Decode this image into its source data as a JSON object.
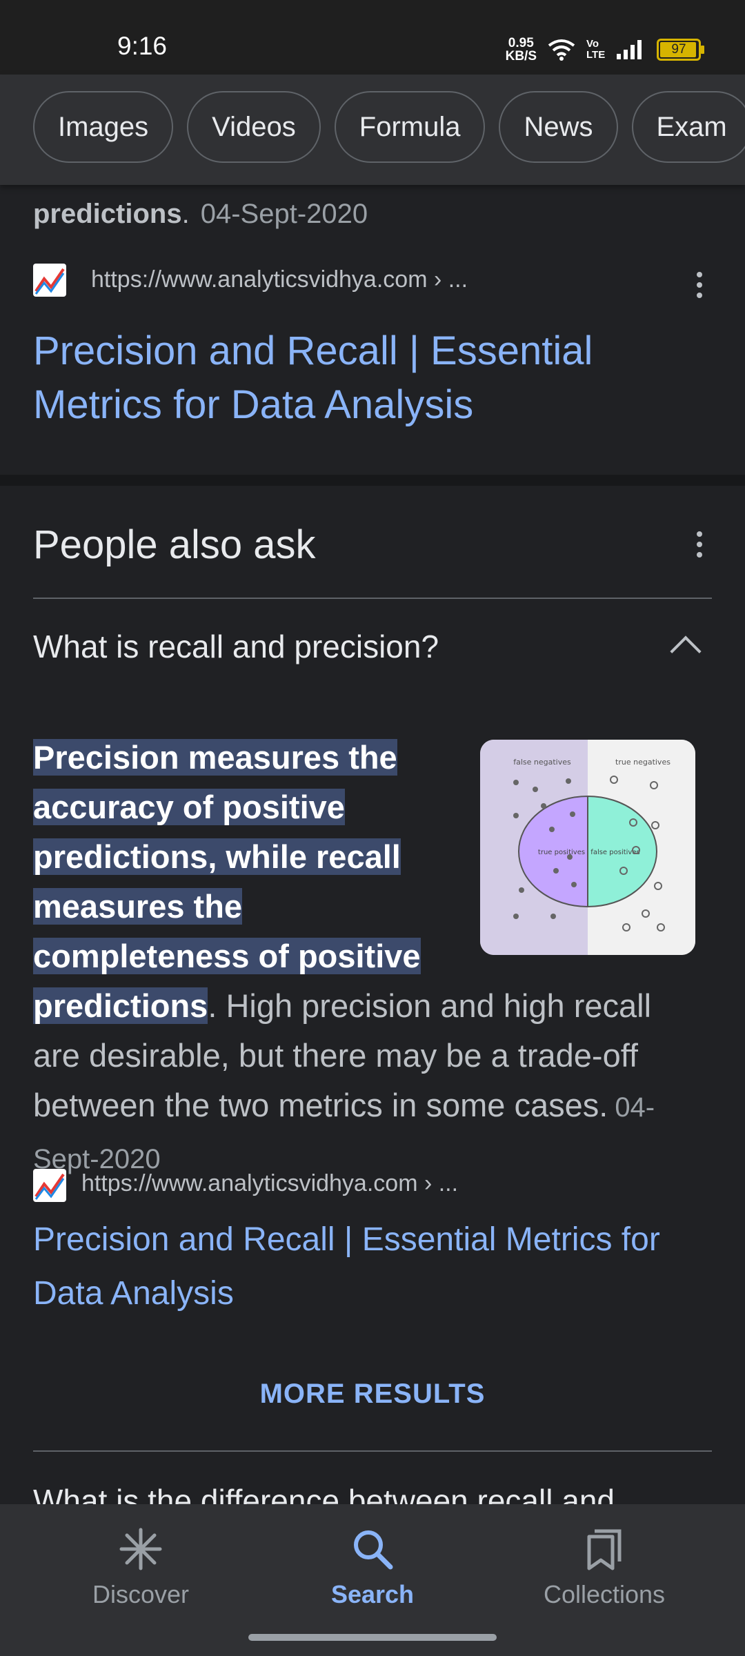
{
  "status_bar": {
    "time": "9:16",
    "speed_value": "0.95",
    "speed_unit": "KB/S",
    "volte": "Vo LTE",
    "battery": "97",
    "battery_level_pct": 97
  },
  "filter_chips": [
    "Images",
    "Videos",
    "Formula",
    "News",
    "Exam"
  ],
  "top_result": {
    "snippet_bold": "predictions",
    "snippet_end": ".",
    "date": "04-Sept-2020",
    "url": "https://www.analyticsvidhya.com › ...",
    "title": "Precision and Recall | Essential Metrics for Data Analysis"
  },
  "people_also_ask": {
    "heading": "People also ask",
    "question": "What is recall and precision?",
    "answer_highlight": "Precision measures the accuracy of positive predictions, while recall measures the completeness of positive predictions",
    "answer_rest": ". High precision and high recall are desirable, but there may be a trade-off between the two metrics in some cases.",
    "answer_date": "04-Sept-2020",
    "image_labels": {
      "false_negatives": "false negatives",
      "true_negatives": "true negatives",
      "true_positives": "true positives",
      "false_positives": "false positives"
    },
    "source_url": "https://www.analyticsvidhya.com › ...",
    "source_title": "Precision and Recall | Essential Metrics for Data Analysis",
    "more_results": "MORE RESULTS",
    "next_question": "What is the difference between recall and"
  },
  "bottom_nav": {
    "items": [
      {
        "label": "Discover",
        "icon": "asterisk-icon"
      },
      {
        "label": "Search",
        "icon": "search-icon"
      },
      {
        "label": "Collections",
        "icon": "collections-icon"
      }
    ],
    "active": "Search"
  },
  "colors": {
    "background": "#202124",
    "link": "#8ab4f8",
    "highlight": "#3c4a6b"
  }
}
